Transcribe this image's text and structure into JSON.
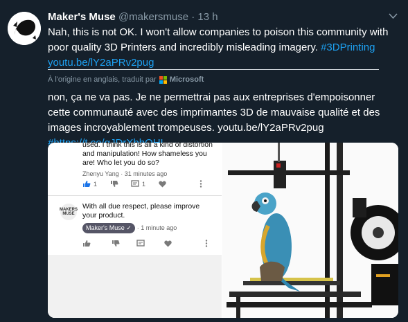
{
  "tweet": {
    "display_name": "Maker's Muse",
    "handle": "@makersmuse",
    "separator": "·",
    "time": "13 h",
    "text_part1": "Nah, this is not OK. I won't allow companies to poison this community with poor quality 3D Printers and incredibly misleading imagery. ",
    "hashtag": "#3DPrinting",
    "link": "youtu.be/lY2aPRv2pug",
    "translation_note": "À l'origine en anglais, traduit par",
    "translator": "Microsoft",
    "translated_text": "non, ça ne va pas. Je ne permettrai pas aux entreprises d'empoisonner cette communauté avec des imprimantes 3D de mauvaise qualité et des images incroyablement trompeuses. youtu.be/lY2aPRv2pug ",
    "translated_link": "#https://t.co/gJDrXbhOHL"
  },
  "media": {
    "comment1_text": "used. I think this is all a kind of distortion and manipulation! How shameless you are! Who let you do so?",
    "comment1_author": "Zhenyu Yang · 31 minutes ago",
    "comment1_likes": "1",
    "comment1_replies": "1",
    "comment2_logo": "MAKERS MUSE",
    "comment2_text": "With all due respect, please improve your product.",
    "comment2_author": "Maker's Muse ✓",
    "comment2_time": "· 1 minute ago"
  },
  "colors": {
    "background": "#15202b",
    "link": "#1da1f2",
    "muted": "#8899a6"
  },
  "icons": [
    "avatar-logo",
    "chevron-down-icon",
    "microsoft-logo",
    "thumb-up-icon",
    "thumb-down-icon",
    "reply-icon",
    "heart-icon",
    "more-vert-icon"
  ]
}
